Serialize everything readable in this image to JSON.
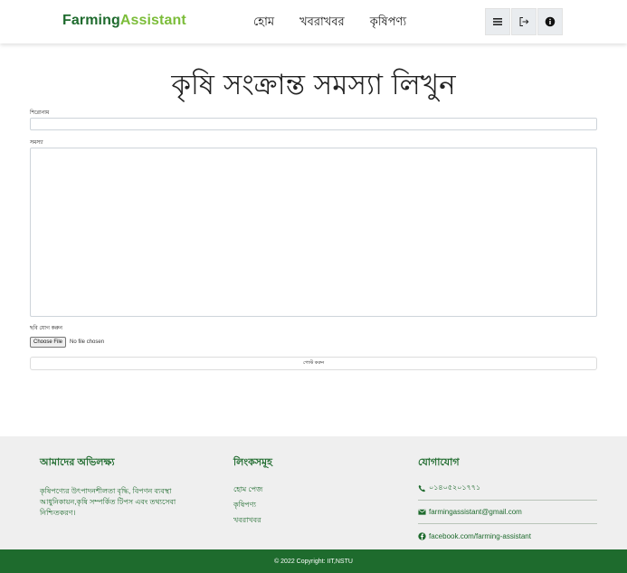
{
  "nav": {
    "brand_part1": "Farming",
    "brand_part2": "Assistant",
    "links": [
      "হোম",
      "খবরাখবর",
      "কৃষিপণ্য"
    ],
    "icons": [
      "bars-icon",
      "logout-icon",
      "info-icon"
    ]
  },
  "main": {
    "page_title": "কৃষি সংক্রান্ত সমস্যা লিখুন",
    "title_label": "শিরোনাম",
    "title_value": "",
    "problem_label": "সমস্যা",
    "problem_value": "",
    "image_label": "ছবি যোগ করুন",
    "file_button": "Choose File",
    "file_status": "No file chosen",
    "submit_label": "পোস্ট করুন"
  },
  "footer": {
    "mission_heading": "আমাদের অভিলক্ষ্য",
    "mission_text": "কৃষিপণ্যের উৎপাদনশীলতা বৃদ্ধি, বিপণন ব্যবস্থা আধুনিকায়ন,কৃষি সম্পর্কিত টিপস এবং তথ্যসেবা নিশ্চিতকরণ।",
    "links_heading": "লিংকসমূহ",
    "links": [
      "হোম পেজ",
      "কৃষিপণ্য",
      "খবরাখবর"
    ],
    "contact_heading": "যোগাযোগ",
    "phone": "০১৪০৫২০১৭৭১",
    "email": "farmingassistant@gmail.com",
    "facebook": "facebook.com/farming-assistant",
    "copyright": "© 2022 Copyright: IIT,NSTU"
  },
  "colors": {
    "brand_dark": "#1f6b2e",
    "brand_light": "#7cbd3a",
    "footer_bar": "#1e6b2d"
  }
}
